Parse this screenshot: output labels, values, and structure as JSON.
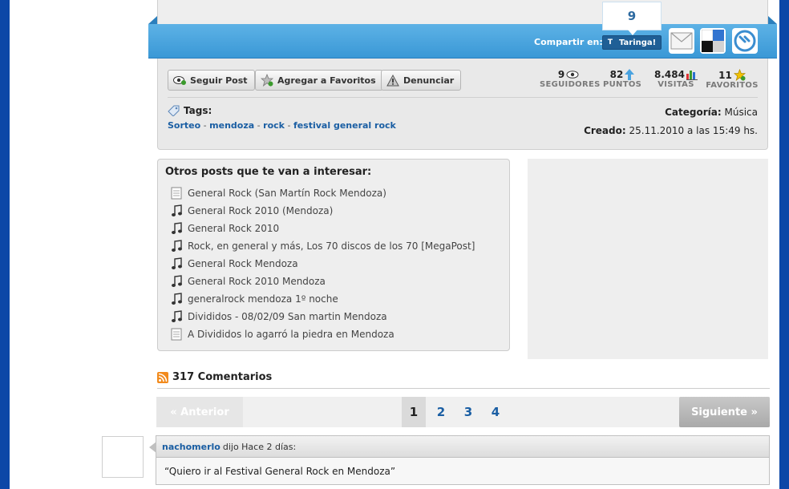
{
  "share": {
    "count": "9",
    "label": "Compartir en:",
    "taringa_button": "Taringa!",
    "taringa_icon_letter": "T"
  },
  "actions": {
    "follow": "Seguir Post",
    "favorite": "Agregar a Favoritos",
    "report": "Denunciar"
  },
  "stats": {
    "followers": {
      "value": "9",
      "label": "SEGUIDORES"
    },
    "points": {
      "value": "82",
      "label": "PUNTOS"
    },
    "visits": {
      "value": "8.484",
      "label": "VISITAS"
    },
    "favorites": {
      "value": "11",
      "label": "FAVORITOS"
    }
  },
  "tags": {
    "title": "Tags:",
    "items": [
      "Sorteo",
      "mendoza",
      "rock",
      "festival general rock"
    ],
    "separator": " - "
  },
  "meta": {
    "category_label": "Categoría:",
    "category_value": "Música",
    "created_label": "Creado:",
    "created_value": "25.11.2010 a las 15:49 hs."
  },
  "related": {
    "title": "Otros posts que te van a interesar:",
    "items": [
      {
        "label": "General Rock (San Martín Rock Mendoza)",
        "icon": "document-icon"
      },
      {
        "label": "General Rock 2010 (Mendoza)",
        "icon": "music-note-icon"
      },
      {
        "label": "General Rock 2010",
        "icon": "music-note-icon"
      },
      {
        "label": "Rock, en general y más, Los 70 discos de los 70 [MegaPost]",
        "icon": "music-note-icon"
      },
      {
        "label": "General Rock Mendoza",
        "icon": "music-note-icon"
      },
      {
        "label": "General Rock 2010 Mendoza",
        "icon": "music-note-icon"
      },
      {
        "label": "generalrock mendoza 1º noche",
        "icon": "music-note-icon"
      },
      {
        "label": "Divididos - 08/02/09 San martin Mendoza",
        "icon": "music-note-icon"
      },
      {
        "label": "A Divididos lo agarró la piedra en Mendoza",
        "icon": "document-icon"
      }
    ]
  },
  "comments": {
    "title": "317 Comentarios",
    "pager": {
      "prev": "« Anterior",
      "pages": [
        "1",
        "2",
        "3",
        "4"
      ],
      "current": "1",
      "next": "Siguiente »"
    },
    "first": {
      "user": "nachomerlo",
      "meta": "dijo Hace 2 días:",
      "text": "“Quiero ir al Festival General Rock en Mendoza”"
    }
  },
  "colors": {
    "frame": "#0c47a7",
    "share_bar": "#3a98d6",
    "link": "#1a5ea3"
  }
}
